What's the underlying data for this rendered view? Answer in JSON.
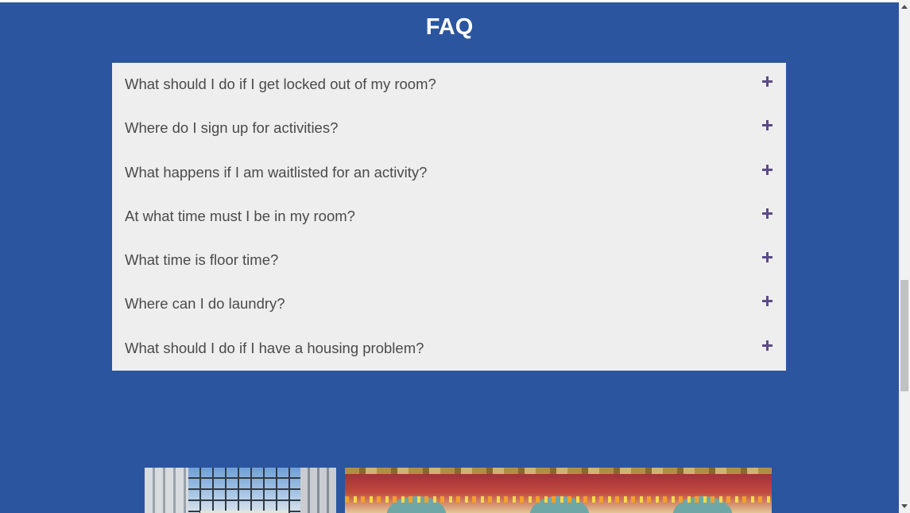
{
  "page": {
    "title": "FAQ"
  },
  "faq": {
    "items": [
      {
        "question": "What should I do if I get locked out of my room?"
      },
      {
        "question": "Where do I sign up for activities?"
      },
      {
        "question": "What happens if I am waitlisted for an activity?"
      },
      {
        "question": "At what time must I be in my room?"
      },
      {
        "question": "What time is floor time?"
      },
      {
        "question": "Where can I do laundry?"
      },
      {
        "question": "What should I do if I have a housing problem?"
      }
    ],
    "expand_icon": "plus-icon"
  },
  "colors": {
    "background": "#2b559e",
    "panel": "#eeeeee",
    "question_text": "#4a4a4a",
    "icon": "#5b4a8c",
    "title": "#ffffff"
  },
  "images": [
    {
      "name": "building-atrium-photo"
    },
    {
      "name": "carousel-canopy-photo"
    }
  ]
}
